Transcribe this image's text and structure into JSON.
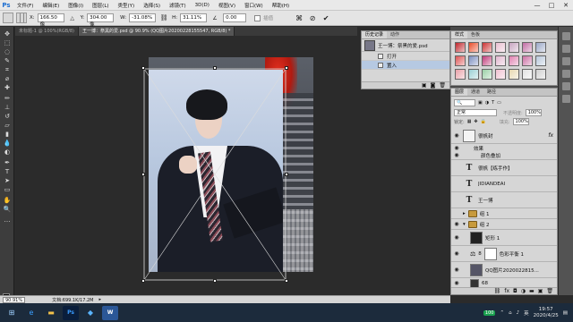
{
  "app": {
    "logo": "Ps",
    "menu": [
      "文件(F)",
      "编辑(E)",
      "图像(I)",
      "图层(L)",
      "类型(Y)",
      "选择(S)",
      "滤镜(T)",
      "3D(D)",
      "视图(V)",
      "窗口(W)",
      "帮助(H)"
    ],
    "window_controls": [
      "—",
      "□",
      "✕"
    ]
  },
  "options": {
    "x_label": "X:",
    "x_value": "166.50 像",
    "y_label": "Y:",
    "y_value": "304.00 像",
    "w_label": "W:",
    "w_value": "-31.08%",
    "h_label": "H:",
    "h_value": "31.11%",
    "angle_value": "0.00",
    "interp_label": "插值",
    "cancel_icon": "cancel-icon",
    "commit_icon": "commit-icon"
  },
  "doc_tabs": [
    "未标题-1 @ 100%(RGB/8)",
    "王一博：祭黑的爱.psd @ 90.9% (QQ图片20200228155547, RGB/8) *"
  ],
  "history": {
    "tabs": [
      "历史记录",
      "动作"
    ],
    "snapshot_name": "王一博：祭黑的爱.psd",
    "items": [
      "打开",
      "置入"
    ]
  },
  "styles": {
    "tabs": [
      "样式",
      "色板"
    ],
    "swatches": [
      "#c0252b",
      "#e94e2a",
      "#c33",
      "#e9bfd0",
      "#c7a4c0",
      "#c16ca3",
      "#9aa7c7",
      "#d55",
      "#7a8dbf",
      "#c03c7a",
      "#e2b7cf",
      "#e080b0",
      "#cc6fa4",
      "#b7c7da",
      "#e8a0a8",
      "#9bd0d5",
      "#9ad0a6",
      "#f0c0d0",
      "#e7d8b0",
      "#e2e2e2",
      "#d0d0d0"
    ]
  },
  "layers": {
    "tabs": [
      "图层",
      "通道",
      "路径"
    ],
    "mode": "正常",
    "opacity_label": "不透明度:",
    "opacity_value": "100%",
    "fill_label": "填充:",
    "fill_value": "100%",
    "items": [
      {
        "name": "很帆封",
        "kind": "image",
        "fx": "fx",
        "visible": true
      },
      {
        "name": "效果",
        "kind": "sub",
        "visible": true
      },
      {
        "name": "颜色叠加",
        "kind": "sub2",
        "visible": true
      },
      {
        "name": "很帆【练手作】",
        "kind": "text",
        "visible": false
      },
      {
        "name": "JIDIANDEAI",
        "kind": "text",
        "visible": false
      },
      {
        "name": "王一博",
        "kind": "text",
        "visible": false
      },
      {
        "name": "组 1",
        "kind": "group",
        "visible": false
      },
      {
        "name": "组 2",
        "kind": "group-open",
        "visible": true
      },
      {
        "name": "矩形 1",
        "kind": "shape",
        "visible": true
      },
      {
        "name": "色彩平衡 1",
        "kind": "adjust",
        "visible": true
      },
      {
        "name": "QQ图片2020022815...",
        "kind": "image",
        "visible": true
      },
      {
        "name": "68",
        "kind": "image",
        "visible": true
      }
    ]
  },
  "status": {
    "zoom": "90.91%",
    "doc_info": "文档:699.1K/17.2M"
  },
  "taskbar": {
    "battery": "100",
    "time": "19:57",
    "date": "2020/4/25",
    "ime": "英"
  }
}
